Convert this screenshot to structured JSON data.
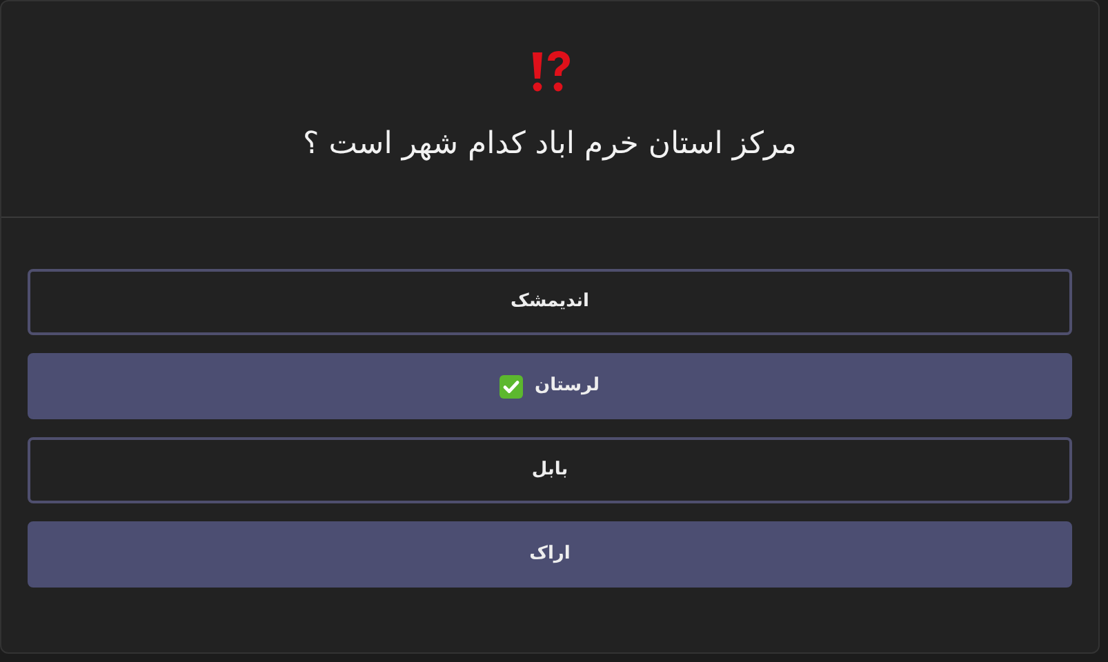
{
  "question": "مرکز استان خرم اباد کدام شهر است ؟",
  "options": [
    {
      "label": "اندیمشک",
      "kind": "outline",
      "correct": false
    },
    {
      "label": "لرستان",
      "kind": "filled",
      "correct": true
    },
    {
      "label": "بابل",
      "kind": "outline",
      "correct": false
    },
    {
      "label": "اراک",
      "kind": "filled",
      "correct": false
    }
  ]
}
